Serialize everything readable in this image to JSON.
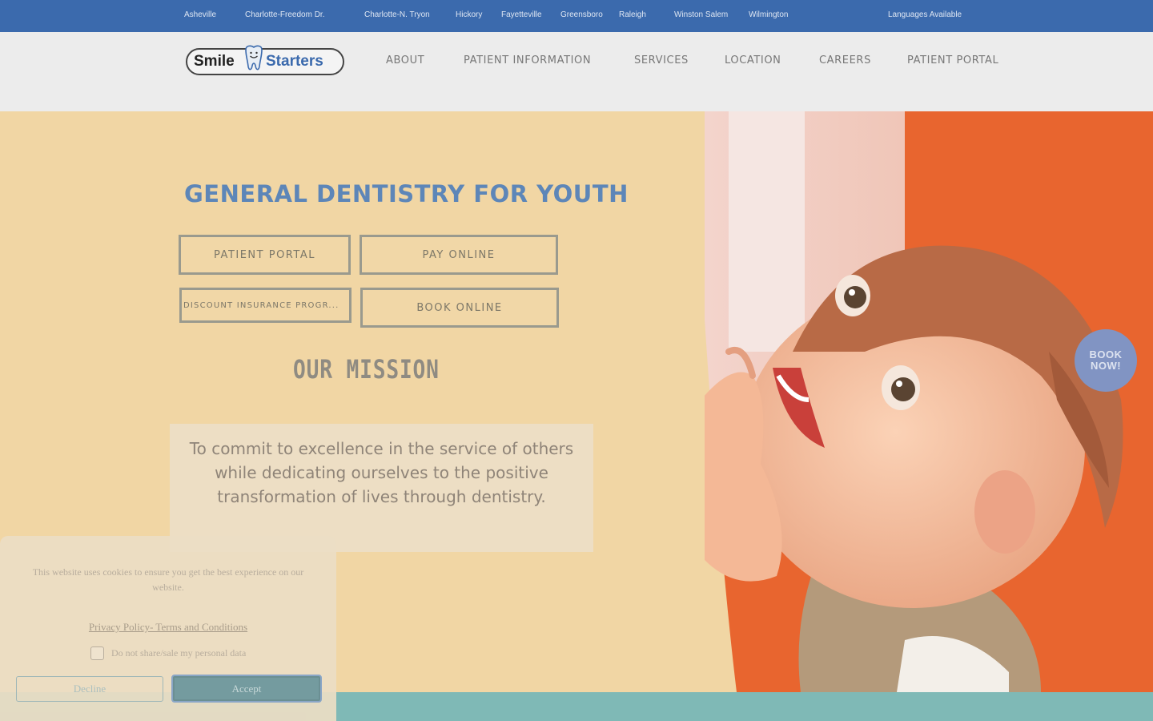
{
  "locations": [
    "Asheville",
    "Charlotte-Freedom Dr.",
    "Charlotte-N. Tryon",
    "Hickory",
    "Fayetteville",
    "Greensboro",
    "Raleigh",
    "Winston Salem",
    "Wilmington"
  ],
  "languages_label": "Languages Available",
  "logo": {
    "part1": "Smile",
    "part2": "Starters"
  },
  "nav": [
    "ABOUT",
    "PATIENT INFORMATION",
    "SERVICES",
    "LOCATION",
    "CAREERS",
    "PATIENT PORTAL"
  ],
  "hero": {
    "title": "GENERAL DENTISTRY FOR YOUTH",
    "buttons": {
      "patient_portal": "PATIENT PORTAL",
      "pay_online": "PAY ONLINE",
      "discount": "DISCOUNT INSURANCE PROGR...",
      "book_online": "BOOK ONLINE"
    },
    "mission_title": "OUR MISSION",
    "mission_text": "To commit to excellence in the service of others while dedicating ourselves to the positive transformation of lives through dentistry."
  },
  "book_now": {
    "line1": "BOOK",
    "line2": "NOW!"
  },
  "cookie": {
    "message": "This website uses cookies to ensure you get the best experience on our website.",
    "policy_link": "Privacy Policy- Terms and Conditions",
    "checkbox_label": "Do not share/sale my personal data",
    "decline": "Decline",
    "accept": "Accept"
  },
  "colors": {
    "topbar": "#3b6aad",
    "hero_bg": "#f1d6a4",
    "title_blue": "#5d86b8",
    "photo_orange": "#e7652f",
    "band_teal": "#7fb9b6"
  }
}
